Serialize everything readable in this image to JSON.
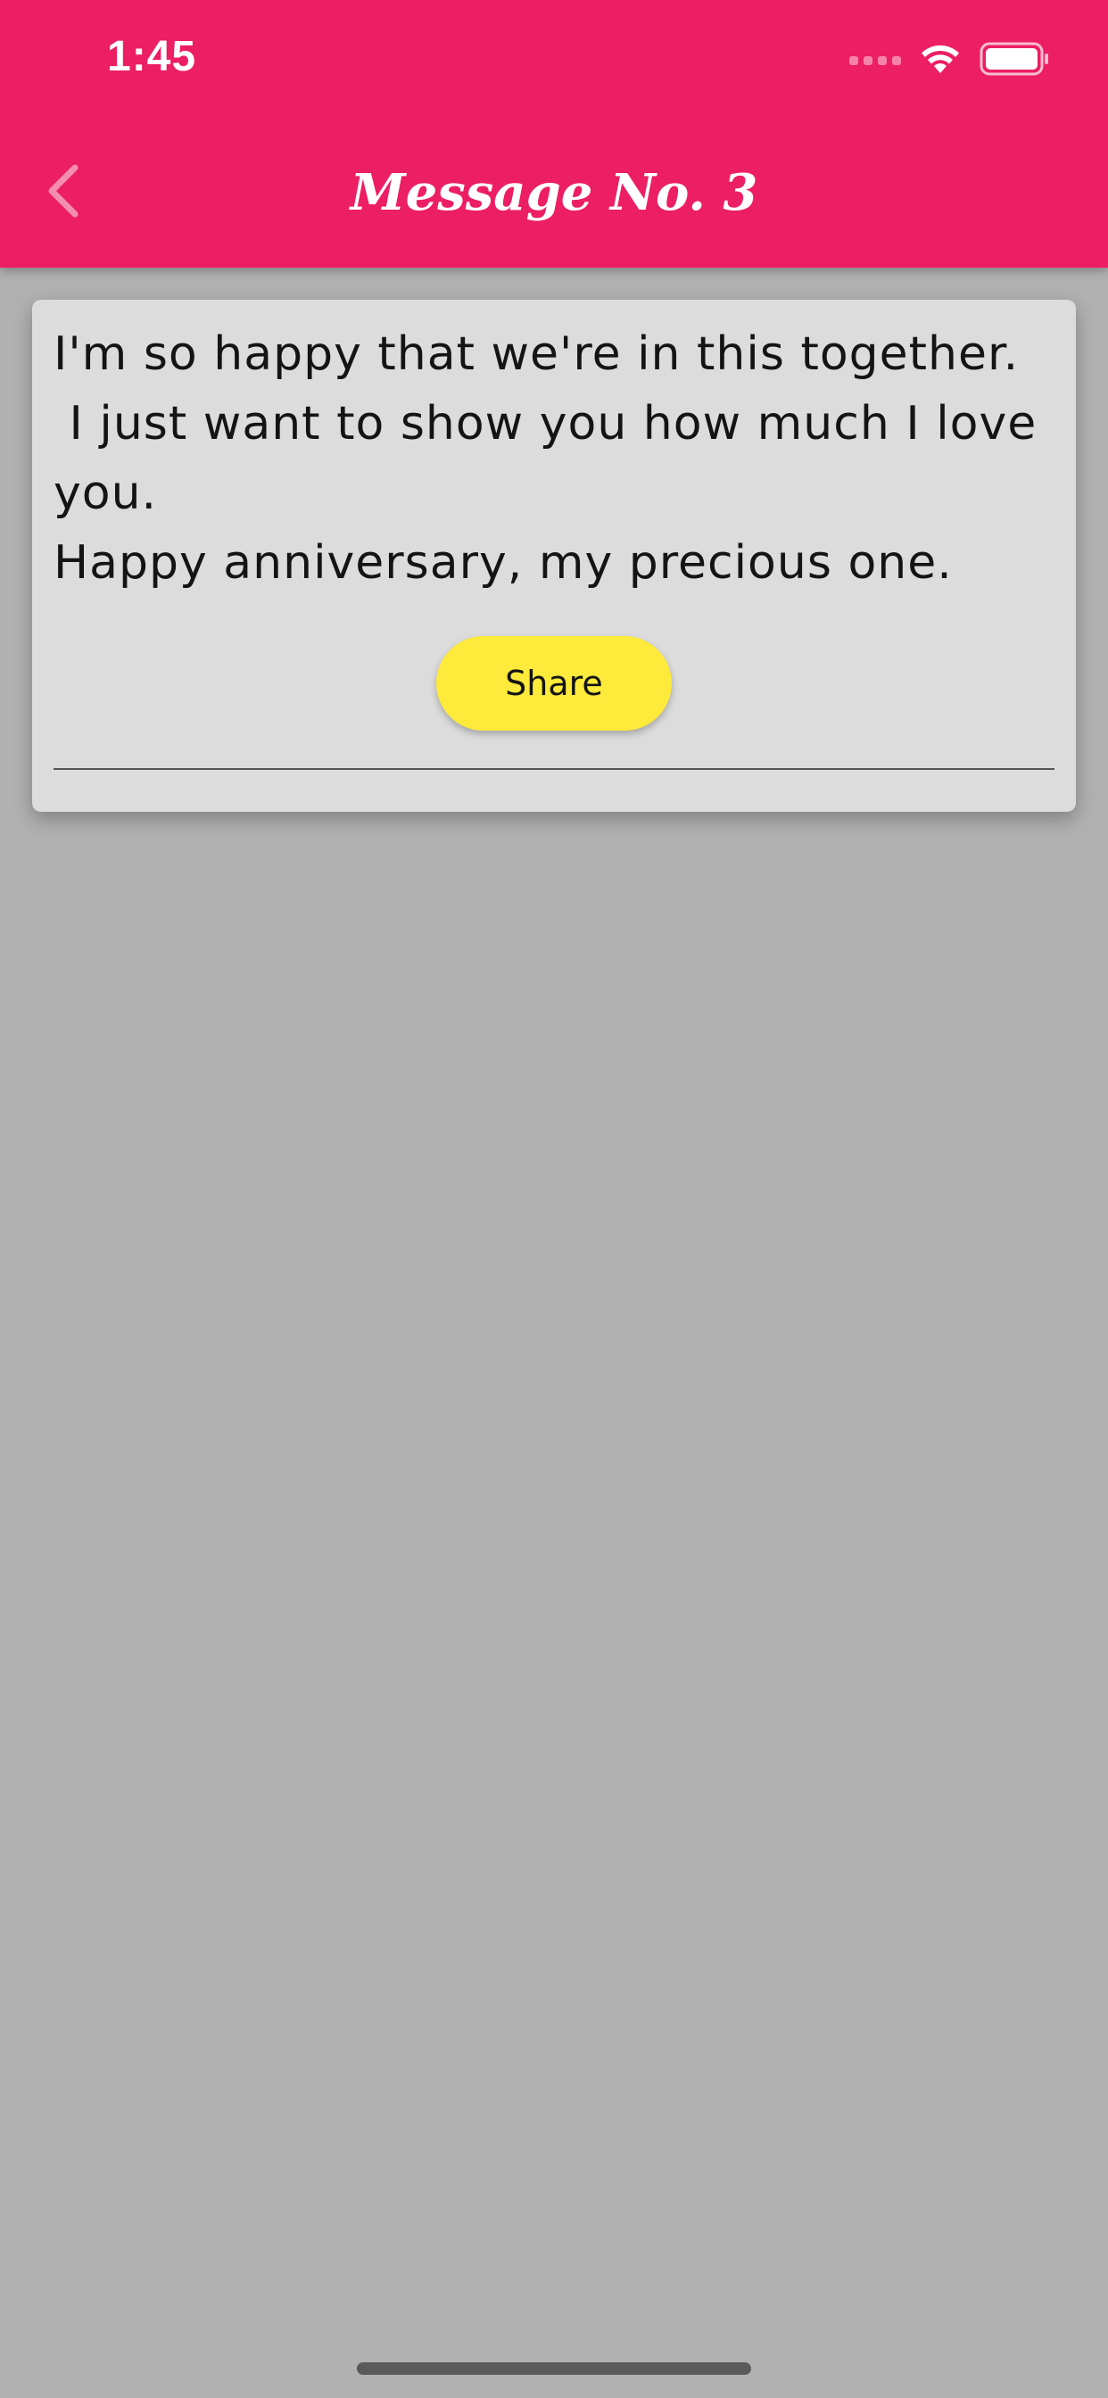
{
  "status_bar": {
    "time": "1:45",
    "wifi_icon": "wifi-icon",
    "battery_icon": "battery-icon"
  },
  "header": {
    "title": "Message No. 3",
    "back_icon": "chevron-left-icon",
    "background_color": "#ec1e64"
  },
  "card": {
    "message": "I'm so happy that we're in this together.\n I just want to show you how much I love you.\nHappy anniversary, my precious one.",
    "share_label": "Share",
    "share_color": "#feea3a"
  },
  "colors": {
    "page_background": "#b1b1b1",
    "card_background": "#dcdcdc"
  }
}
